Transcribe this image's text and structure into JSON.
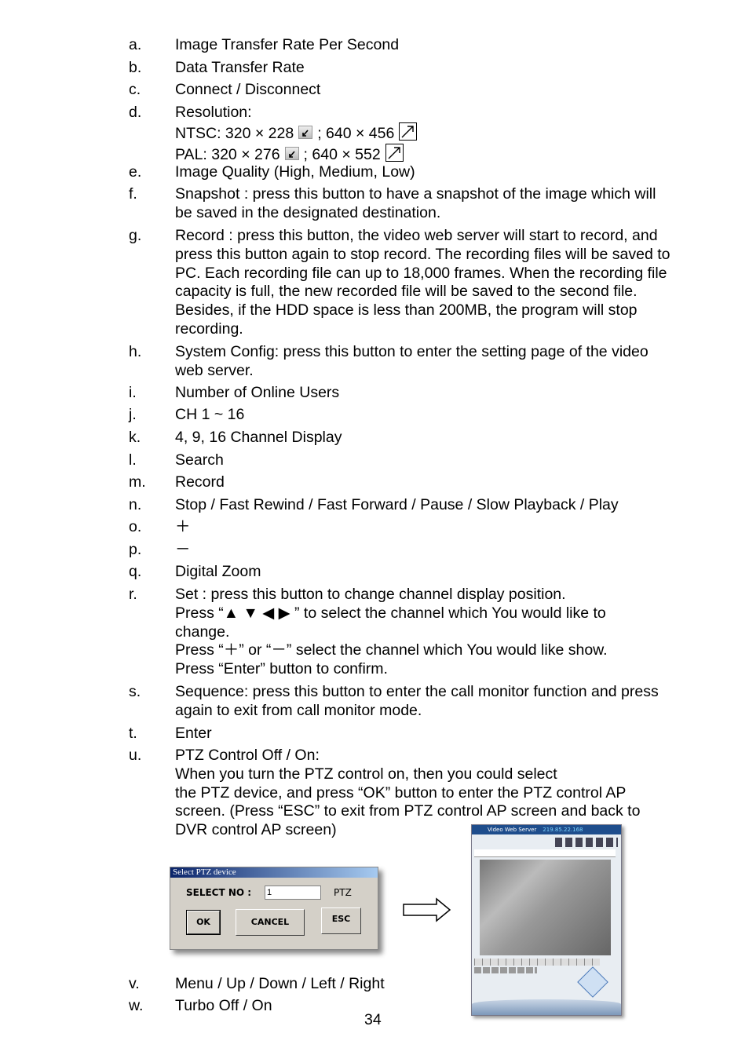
{
  "items": [
    {
      "letter": "a.",
      "lines": [
        "Image Transfer Rate Per Second"
      ]
    },
    {
      "letter": "b.",
      "lines": [
        "Data Transfer Rate"
      ]
    },
    {
      "letter": "c.",
      "lines": [
        "Connect / Disconnect"
      ]
    },
    {
      "letter": "d.",
      "lines": [
        "Resolution:"
      ],
      "resolution": {
        "ntsc": {
          "label": "NTSC: 320 × 228",
          "large": "; 640 × 456"
        },
        "pal": {
          "label": "PAL:    320 × 276",
          "large": "; 640 × 552"
        },
        "icons": [
          "shrink-window-icon",
          "enlarge-window-icon"
        ]
      }
    },
    {
      "letter": "e.",
      "lines": [
        "Image Quality (High, Medium, Low)"
      ]
    },
    {
      "letter": "f.",
      "lines": [
        "Snapshot : press this button to have a snapshot of the image which will",
        "be saved in the designated destination."
      ]
    },
    {
      "letter": "g.",
      "lines": [
        "Record : press this button, the video web server will start to record, and",
        "press this button again to stop record. The recording files will be saved to",
        "PC. Each recording file can up to 18,000 frames. When the recording file",
        "capacity is full, the new recorded file will be saved to the second file.",
        "Besides, if the HDD space is less  than 200MB, the program will stop",
        "recording."
      ]
    },
    {
      "letter": "h.",
      "lines": [
        "System Config: press this button to enter the setting page of the video",
        "web server."
      ]
    },
    {
      "letter": "i.",
      "lines": [
        "Number of Online Users"
      ]
    },
    {
      "letter": "j.",
      "lines": [
        "CH 1 ~ 16"
      ]
    },
    {
      "letter": "k.",
      "lines": [
        "4, 9, 16 Channel Display"
      ]
    },
    {
      "letter": "l.",
      "lines": [
        "Search"
      ]
    },
    {
      "letter": "m.",
      "lines": [
        "Record"
      ]
    },
    {
      "letter": "n.",
      "lines": [
        "Stop / Fast Rewind / Fast Forward / Pause / Slow Playback / Play"
      ]
    },
    {
      "letter": "o.",
      "lines": [
        "＋"
      ]
    },
    {
      "letter": "p.",
      "lines": [
        "－"
      ]
    },
    {
      "letter": "q.",
      "lines": [
        "Digital Zoom"
      ]
    },
    {
      "letter": "r.",
      "lines": [
        "Set : press this button to change channel display position.",
        "Press “▲ ▼  ◀   ▶ ” to select the channel which You would like to",
        "change.",
        "Press “＋” or “－” select the channel which You would like show.",
        "Press “Enter” button to confirm."
      ]
    },
    {
      "letter": "s.",
      "lines": [
        "Sequence: press this button to enter the call monitor function and press",
        "again to exit from call monitor mode."
      ]
    },
    {
      "letter": "t.",
      "lines": [
        "Enter"
      ]
    },
    {
      "letter": "u.",
      "lines": [
        "PTZ Control Off / On:",
        "When you turn the PTZ control on, then you could select",
        "the PTZ device, and press “OK” button to enter the PTZ control AP",
        "screen. (Press “ESC” to exit from PTZ control AP screen and back to",
        "DVR control AP screen)"
      ]
    },
    {
      "letter": "v.",
      "lines": [
        "Menu / Up / Down / Left / Right"
      ]
    },
    {
      "letter": "w.",
      "lines": [
        "Turbo Off / On"
      ]
    }
  ],
  "dialog": {
    "title": "Select PTZ device",
    "select_label": "SELECT  NO :",
    "select_value": "1",
    "ptz_label": "PTZ",
    "ok": "OK",
    "cancel": "CANCEL",
    "esc": "ESC"
  },
  "screenshot": {
    "title": "Video Web Server",
    "ip": "219.85.22.168"
  },
  "page_number": "34"
}
